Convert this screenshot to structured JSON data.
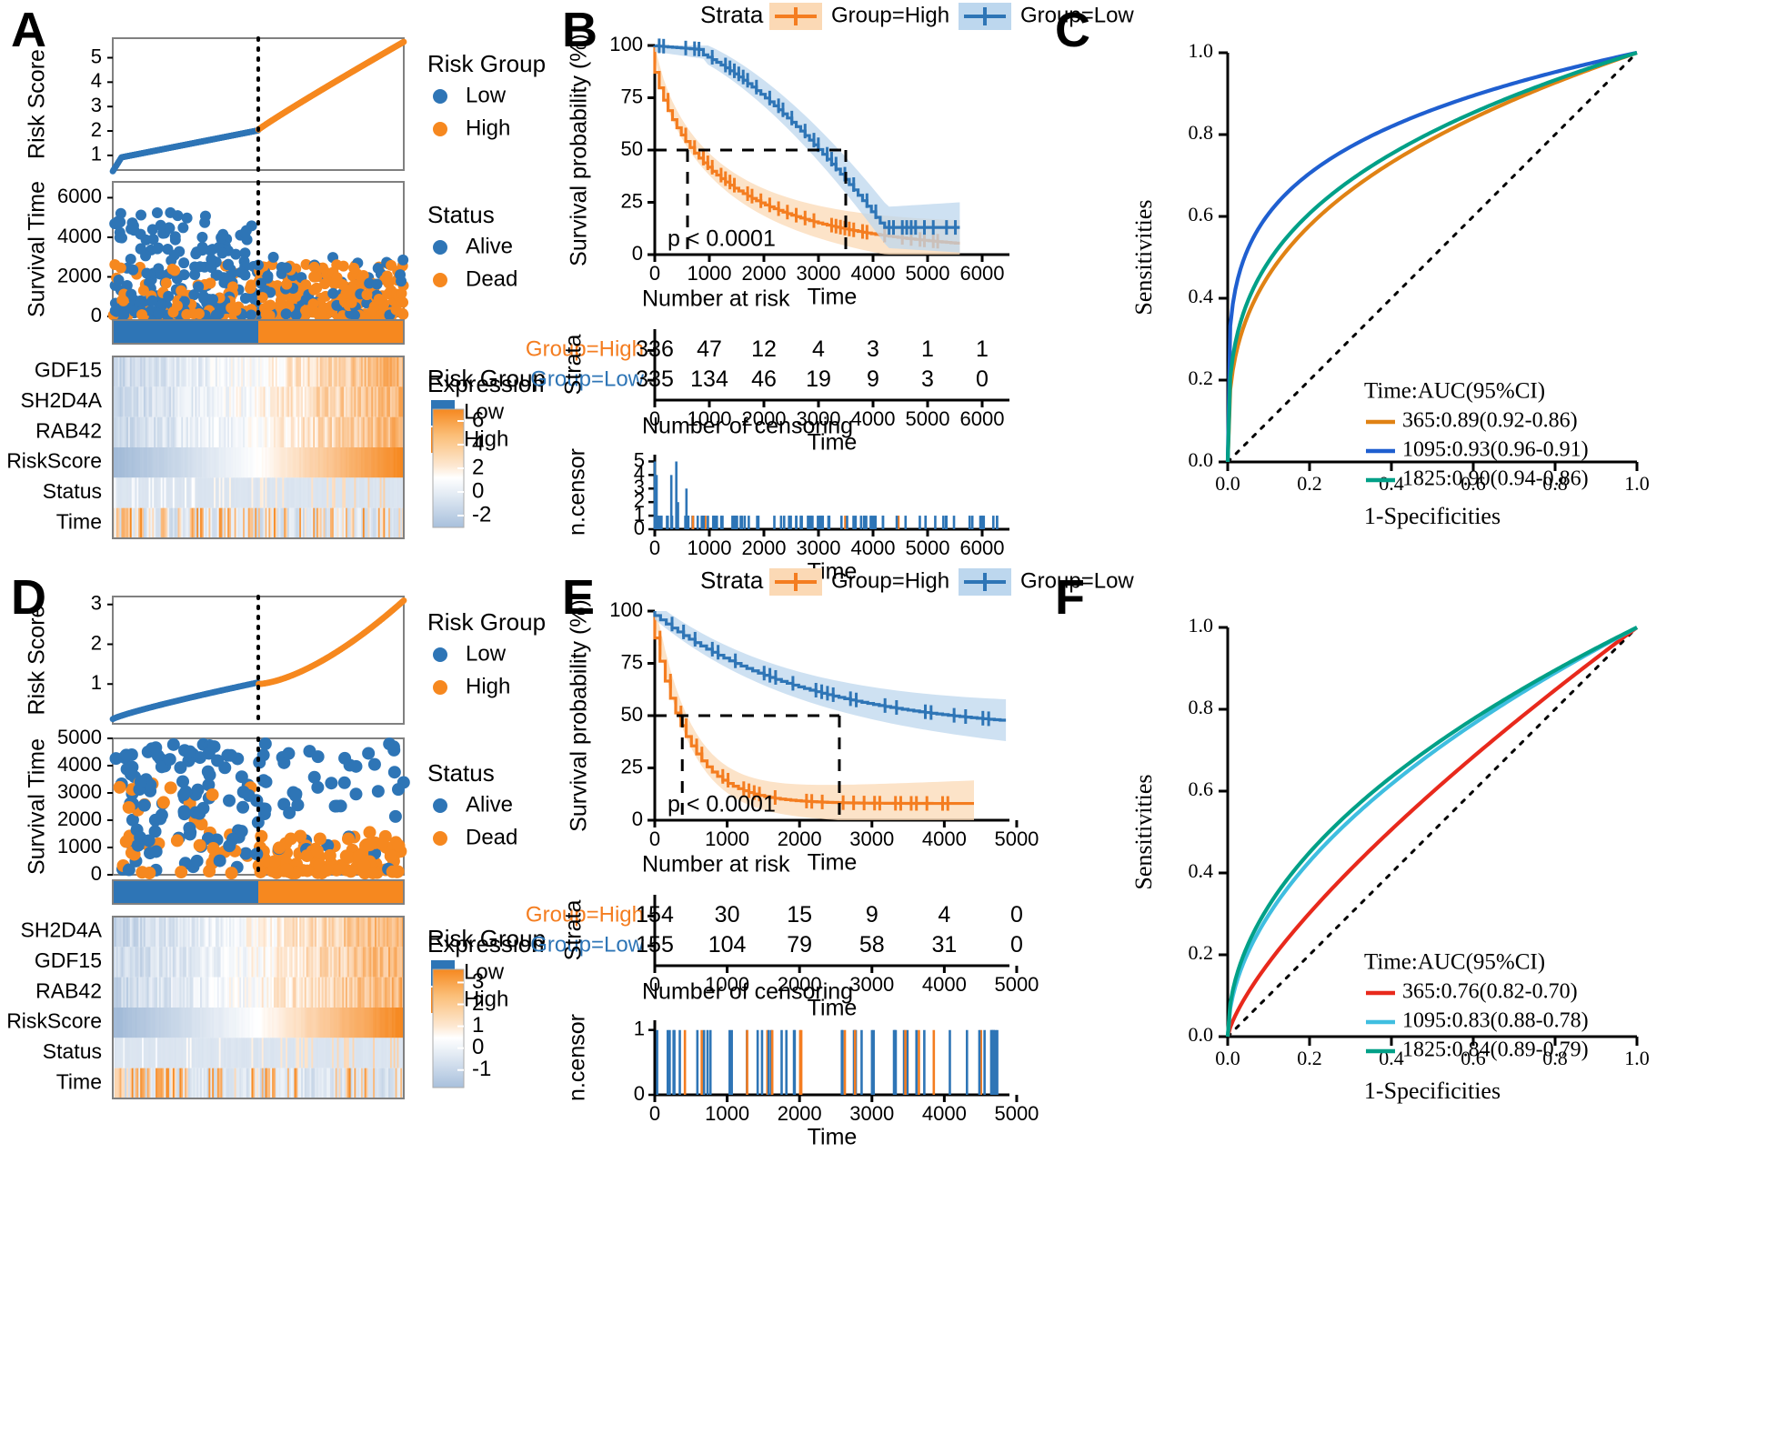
{
  "figure": {
    "panels": [
      "A",
      "B",
      "C",
      "D",
      "E",
      "F"
    ]
  },
  "colors": {
    "low_blue": "#2E75B6",
    "high_orange": "#F6881F",
    "km_blue": "#2E75B6",
    "km_orange": "#F47D20",
    "band_blue": "#BDD7EE",
    "band_orange": "#FBD9B5",
    "roc_orange": "#E08214",
    "roc_blue": "#1F5FD0",
    "roc_teal": "#00A087",
    "roc_red": "#E8291C",
    "roc_cyan": "#3FBEE0",
    "heat_high": "#F6881F",
    "heat_low": "#B8CCE4",
    "diagonal": "#000000"
  },
  "panelA": {
    "label": "A",
    "riskscore": {
      "ylabel": "Risk Score",
      "yticks": [
        "1",
        "2",
        "3",
        "4",
        "5"
      ],
      "ylim": [
        0.4,
        5.8
      ],
      "cutoff_label": "cutoff",
      "legend": {
        "title": "Risk Group",
        "items": [
          {
            "label": "Low",
            "color": "#2E75B6"
          },
          {
            "label": "High",
            "color": "#F6881F"
          }
        ]
      }
    },
    "survtime": {
      "ylabel": "Survival Time",
      "yticks": [
        "0",
        "2000",
        "4000",
        "6000"
      ],
      "ylim": [
        0,
        6800
      ],
      "legend": {
        "title": "Status",
        "items": [
          {
            "label": "Alive",
            "color": "#2E75B6"
          },
          {
            "label": "Dead",
            "color": "#F6881F"
          }
        ]
      }
    },
    "groupbar": {
      "legend": {
        "title": "Risk Group",
        "items": [
          {
            "label": "Low",
            "color": "#2E75B6"
          },
          {
            "label": "High",
            "color": "#F6881F"
          }
        ]
      },
      "low_fraction": 0.5
    },
    "heatmap": {
      "rows": [
        "GDF15",
        "SH2D4A",
        "RAB42",
        "RiskScore",
        "Status",
        "Time"
      ],
      "legend": {
        "title": "Expression",
        "ticks": [
          "6",
          "4",
          "2",
          "0",
          "-2"
        ],
        "min": -3,
        "max": 7
      }
    }
  },
  "panelB": {
    "label": "B",
    "km": {
      "ylabel": "Survival probability (%)",
      "xlabel": "Time",
      "yticks": [
        "0",
        "25",
        "50",
        "75",
        "100"
      ],
      "xticks": [
        "0",
        "1000",
        "2000",
        "3000",
        "4000",
        "5000",
        "6000"
      ],
      "xlim": [
        0,
        6500
      ],
      "ylim": [
        0,
        100
      ],
      "strata_title": "Strata",
      "strata": [
        {
          "label": "Group=High",
          "color": "#F47D20"
        },
        {
          "label": "Group=Low",
          "color": "#2E75B6"
        }
      ],
      "pvalue": "p < 0.0001",
      "median_high": 600,
      "median_low": 3500
    },
    "risk_table": {
      "title": "Number at risk",
      "ylabel": "Strata",
      "xlabel": "Time",
      "xticks": [
        "0",
        "1000",
        "2000",
        "3000",
        "4000",
        "5000",
        "6000"
      ],
      "rows": [
        {
          "label": "Group=High",
          "color": "#F47D20",
          "values": [
            "336",
            "47",
            "12",
            "4",
            "3",
            "1",
            "1"
          ]
        },
        {
          "label": "Group=Low",
          "color": "#2E75B6",
          "values": [
            "335",
            "134",
            "46",
            "19",
            "9",
            "3",
            "0"
          ]
        }
      ]
    },
    "censor": {
      "title": "Number of censoring",
      "ylabel": "n.censor",
      "xlabel": "Time",
      "yticks": [
        "0",
        "1",
        "2",
        "3",
        "4",
        "5"
      ],
      "xticks": [
        "0",
        "1000",
        "2000",
        "3000",
        "4000",
        "5000",
        "6000"
      ],
      "ylim": [
        0,
        5.5
      ]
    }
  },
  "panelC": {
    "label": "C",
    "roc": {
      "xlabel": "1-Specificities",
      "ylabel": "Sensitivities",
      "xticks": [
        "0.0",
        "0.2",
        "0.4",
        "0.6",
        "0.8",
        "1.0"
      ],
      "yticks": [
        "0.0",
        "0.2",
        "0.4",
        "0.6",
        "0.8",
        "1.0"
      ],
      "legend_title": "Time:AUC(95%CI)",
      "curves": [
        {
          "label": "365:0.89(0.92-0.86)",
          "color": "#E08214",
          "auc": 0.89
        },
        {
          "label": "1095:0.93(0.96-0.91)",
          "color": "#1F5FD0",
          "auc": 0.93
        },
        {
          "label": "1825:0.90(0.94-0.86)",
          "color": "#00A087",
          "auc": 0.9
        }
      ]
    }
  },
  "panelD": {
    "label": "D",
    "riskscore": {
      "ylabel": "Risk Score",
      "yticks": [
        "1",
        "2",
        "3"
      ],
      "ylim": [
        0,
        3.2
      ],
      "legend": {
        "title": "Risk Group",
        "items": [
          {
            "label": "Low",
            "color": "#2E75B6"
          },
          {
            "label": "High",
            "color": "#F6881F"
          }
        ]
      }
    },
    "survtime": {
      "ylabel": "Survival Time",
      "yticks": [
        "0",
        "1000",
        "2000",
        "3000",
        "4000",
        "5000"
      ],
      "ylim": [
        0,
        5000
      ],
      "legend": {
        "title": "Status",
        "items": [
          {
            "label": "Alive",
            "color": "#2E75B6"
          },
          {
            "label": "Dead",
            "color": "#F6881F"
          }
        ]
      }
    },
    "groupbar": {
      "legend": {
        "title": "Risk Group",
        "items": [
          {
            "label": "Low",
            "color": "#2E75B6"
          },
          {
            "label": "High",
            "color": "#F6881F"
          }
        ]
      },
      "low_fraction": 0.5
    },
    "heatmap": {
      "rows": [
        "SH2D4A",
        "GDF15",
        "RAB42",
        "RiskScore",
        "Status",
        "Time"
      ],
      "legend": {
        "title": "Expression",
        "ticks": [
          "3",
          "2",
          "1",
          "0",
          "-1"
        ],
        "min": -1.8,
        "max": 3.6
      }
    }
  },
  "panelE": {
    "label": "E",
    "km": {
      "ylabel": "Survival probability (%)",
      "xlabel": "Time",
      "yticks": [
        "0",
        "25",
        "50",
        "75",
        "100"
      ],
      "xticks": [
        "0",
        "1000",
        "2000",
        "3000",
        "4000",
        "5000"
      ],
      "xlim": [
        0,
        4900
      ],
      "ylim": [
        0,
        100
      ],
      "strata_title": "Strata",
      "strata": [
        {
          "label": "Group=High",
          "color": "#F47D20"
        },
        {
          "label": "Group=Low",
          "color": "#2E75B6"
        }
      ],
      "pvalue": "p < 0.0001",
      "median_high": 380,
      "median_low": 2550
    },
    "risk_table": {
      "title": "Number at risk",
      "ylabel": "Strata",
      "xlabel": "Time",
      "xticks": [
        "0",
        "1000",
        "2000",
        "3000",
        "4000",
        "5000"
      ],
      "rows": [
        {
          "label": "Group=High",
          "color": "#F47D20",
          "values": [
            "154",
            "30",
            "15",
            "9",
            "4",
            "0"
          ]
        },
        {
          "label": "Group=Low",
          "color": "#2E75B6",
          "values": [
            "155",
            "104",
            "79",
            "58",
            "31",
            "0"
          ]
        }
      ]
    },
    "censor": {
      "title": "Number of censoring",
      "ylabel": "n.censor",
      "xlabel": "Time",
      "yticks": [
        "0",
        "1"
      ],
      "xticks": [
        "0",
        "1000",
        "2000",
        "3000",
        "4000",
        "5000"
      ],
      "ylim": [
        0,
        1.15
      ]
    }
  },
  "panelF": {
    "label": "F",
    "roc": {
      "xlabel": "1-Specificities",
      "ylabel": "Sensitivities",
      "xticks": [
        "0.0",
        "0.2",
        "0.4",
        "0.6",
        "0.8",
        "1.0"
      ],
      "yticks": [
        "0.0",
        "0.2",
        "0.4",
        "0.6",
        "0.8",
        "1.0"
      ],
      "legend_title": "Time:AUC(95%CI)",
      "curves": [
        {
          "label": "365:0.76(0.82-0.70)",
          "color": "#E8291C",
          "auc": 0.76
        },
        {
          "label": "1095:0.83(0.88-0.78)",
          "color": "#3FBEE0",
          "auc": 0.83
        },
        {
          "label": "1825:0.84(0.89-0.79)",
          "color": "#00A087",
          "auc": 0.84
        }
      ]
    }
  }
}
